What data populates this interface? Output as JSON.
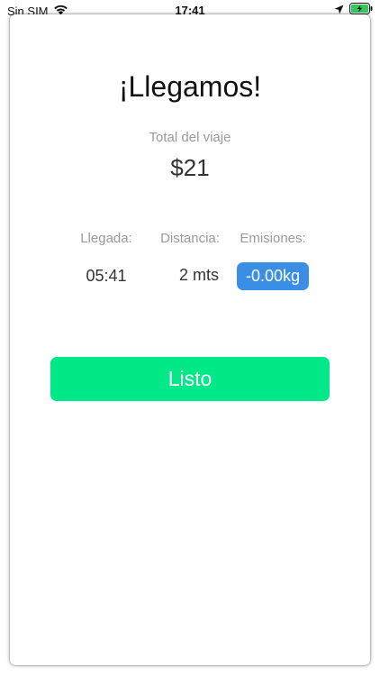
{
  "status_bar": {
    "carrier": "Sin SIM",
    "time": "17:41"
  },
  "trip": {
    "title": "¡Llegamos!",
    "total_label": "Total del viaje",
    "total_value": "$21"
  },
  "stats": {
    "arrival_label": "Llegada:",
    "arrival_value": "05:41",
    "distance_label": "Distancia:",
    "distance_value": "2 mts",
    "emissions_label": "Emisiones:",
    "emissions_value": "-0.00kg"
  },
  "actions": {
    "done_label": "Listo"
  },
  "colors": {
    "accent_green": "#00e887",
    "badge_blue": "#3b8ee5",
    "battery_green": "#34c759"
  },
  "icons": [
    "wifi-icon",
    "location-arrow-icon",
    "battery-charging-icon"
  ]
}
